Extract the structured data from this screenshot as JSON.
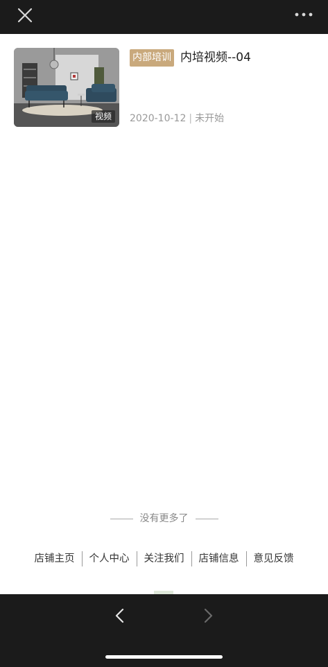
{
  "topbar": {
    "close_icon": "close-icon",
    "more_icon": "more-dots-icon"
  },
  "list": {
    "items": [
      {
        "thumb_badge": "视频",
        "tag": "内部培训",
        "title": "内培视频--04",
        "date": "2020-10-12",
        "separator": "|",
        "status": "未开始"
      }
    ]
  },
  "no_more_text": "没有更多了",
  "footer": {
    "links": [
      "店铺主页",
      "个人中心",
      "关注我们",
      "店铺信息",
      "意见反馈"
    ]
  },
  "bottombar": {
    "back_icon": "chevron-left-icon",
    "forward_icon": "chevron-right-icon"
  },
  "colors": {
    "bar_bg": "#1b1b1b",
    "tag_bg": "#c9a97c",
    "meta_text": "#999999"
  }
}
